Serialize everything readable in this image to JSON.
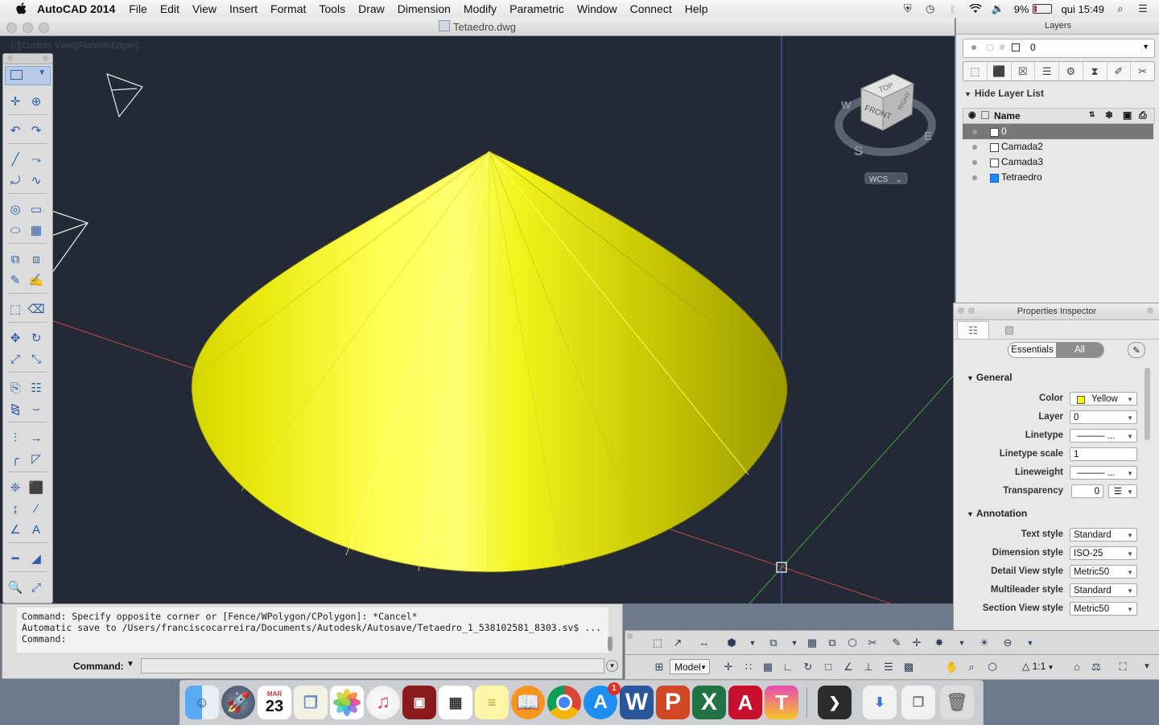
{
  "menubar": {
    "app_name": "AutoCAD 2014",
    "items": [
      "File",
      "Edit",
      "View",
      "Insert",
      "Format",
      "Tools",
      "Draw",
      "Dimension",
      "Modify",
      "Parametric",
      "Window",
      "Connect",
      "Help"
    ],
    "battery": "9%",
    "clock": "qui 15:49"
  },
  "window": {
    "title": "Tetaedro.dwg"
  },
  "viewport": {
    "view_label": "[-][Custom View][FlatWithEdges]",
    "viewcube": {
      "top": "TOP",
      "front": "FRONT",
      "right": "RIGHT",
      "west": "W",
      "east": "E",
      "south": "S"
    },
    "wcs_label": "WCS",
    "cone_color": "#ffff00"
  },
  "command": {
    "history": "Command: Specify opposite corner or [Fence/WPolygon/CPolygon]: *Cancel*\nAutomatic save to /Users/franciscocarreira/Documents/Autodesk/Autosave/Tetaedro_1_538102581_8303.sv$ ...\nCommand:",
    "prompt_label": "Command:"
  },
  "status": {
    "model_label": "Model",
    "scale_label": "1:1"
  },
  "layers_panel": {
    "title": "Layers",
    "current_layer": "0",
    "hide_list_label": "Hide Layer List",
    "name_header": "Name",
    "rows": [
      {
        "name": "0",
        "color": "#ffffff",
        "selected": true
      },
      {
        "name": "Camada2",
        "color": "#ffffff",
        "selected": false
      },
      {
        "name": "Camada3",
        "color": "#ffffff",
        "selected": false
      },
      {
        "name": "Tetraedro",
        "color": "#1a8cff",
        "selected": false
      }
    ]
  },
  "properties": {
    "title": "Properties Inspector",
    "tab_essentials": "Essentials",
    "tab_all": "All",
    "general_label": "General",
    "annotation_label": "Annotation",
    "general": [
      {
        "label": "Color",
        "value": "Yellow"
      },
      {
        "label": "Layer",
        "value": "0"
      },
      {
        "label": "Linetype",
        "value": "——— ..."
      },
      {
        "label": "Linetype scale",
        "value": "1"
      },
      {
        "label": "Lineweight",
        "value": "——— ..."
      },
      {
        "label": "Transparency",
        "value": "0"
      }
    ],
    "annotation": [
      {
        "label": "Text style",
        "value": "Standard"
      },
      {
        "label": "Dimension style",
        "value": "ISO-25"
      },
      {
        "label": "Detail View style",
        "value": "Metric50"
      },
      {
        "label": "Multileader style",
        "value": "Standard"
      },
      {
        "label": "Section View style",
        "value": "Metric50"
      }
    ]
  },
  "dock": {
    "calendar_month": "MAR",
    "calendar_day": "23",
    "appstore_badge": "1"
  }
}
